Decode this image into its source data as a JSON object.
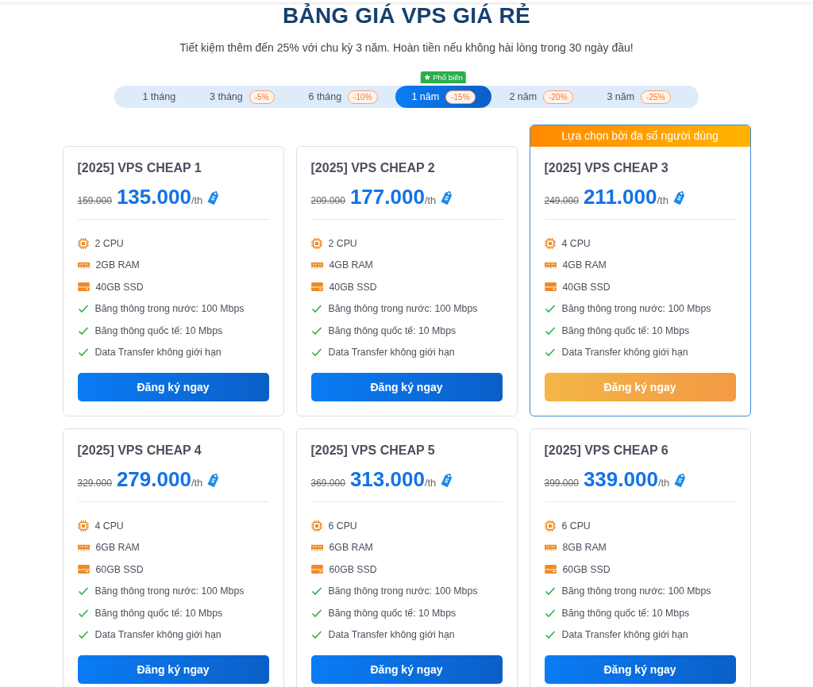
{
  "title": "BẢNG GIÁ VPS GIÁ RẺ",
  "subtitle": "Tiết kiệm thêm đến 25% với chu kỳ 3 năm. Hoàn tiền nếu không hài lòng trong 30 ngày đầu!",
  "tabs": [
    {
      "label": "1 tháng",
      "selected": false
    },
    {
      "label": "3 tháng",
      "discount": "-5%",
      "selected": false
    },
    {
      "label": "6 tháng",
      "discount": "-10%",
      "selected": false
    },
    {
      "label": "1 năm",
      "discount": "-15%",
      "badge": "Phổ biến",
      "selected": true
    },
    {
      "label": "2 năm",
      "discount": "-20%",
      "selected": false
    },
    {
      "label": "3 năm",
      "discount": "-25%",
      "selected": false
    }
  ],
  "plans": [
    {
      "name": "[2025] VPS CHEAP 1",
      "old_price": "159.000",
      "price": "135.000",
      "unit": "/th",
      "featured": false,
      "specs": [
        {
          "kind": "cpu",
          "text": "2 CPU"
        },
        {
          "kind": "ram",
          "text": "2GB RAM"
        },
        {
          "kind": "ssd",
          "text": "40GB SSD"
        },
        {
          "kind": "check",
          "text": "Băng thông trong nước: 100 Mbps"
        },
        {
          "kind": "check",
          "text": "Băng thông quốc tế: 10 Mbps"
        },
        {
          "kind": "check",
          "text": "Data Transfer không giới hạn"
        }
      ],
      "button": "Đăng ký ngay"
    },
    {
      "name": "[2025] VPS CHEAP 2",
      "old_price": "209.000",
      "price": "177.000",
      "unit": "/th",
      "featured": false,
      "specs": [
        {
          "kind": "cpu",
          "text": "2 CPU"
        },
        {
          "kind": "ram",
          "text": "4GB RAM"
        },
        {
          "kind": "ssd",
          "text": "40GB SSD"
        },
        {
          "kind": "check",
          "text": "Băng thông trong nước: 100 Mbps"
        },
        {
          "kind": "check",
          "text": "Băng thông quốc tế: 10 Mbps"
        },
        {
          "kind": "check",
          "text": "Data Transfer không giới hạn"
        }
      ],
      "button": "Đăng ký ngay"
    },
    {
      "name": "[2025] VPS CHEAP 3",
      "old_price": "249.000",
      "price": "211.000",
      "unit": "/th",
      "featured": true,
      "banner": "Lựa chọn bởi đa số người dùng",
      "specs": [
        {
          "kind": "cpu",
          "text": "4 CPU"
        },
        {
          "kind": "ram",
          "text": "4GB RAM"
        },
        {
          "kind": "ssd",
          "text": "40GB SSD"
        },
        {
          "kind": "check",
          "text": "Băng thông trong nước: 100 Mbps"
        },
        {
          "kind": "check",
          "text": "Băng thông quốc tế: 10 Mbps"
        },
        {
          "kind": "check",
          "text": "Data Transfer không giới hạn"
        }
      ],
      "button": "Đăng ký ngay"
    },
    {
      "name": "[2025] VPS CHEAP 4",
      "old_price": "329.000",
      "price": "279.000",
      "unit": "/th",
      "featured": false,
      "specs": [
        {
          "kind": "cpu",
          "text": "4 CPU"
        },
        {
          "kind": "ram",
          "text": "6GB RAM"
        },
        {
          "kind": "ssd",
          "text": "60GB SSD"
        },
        {
          "kind": "check",
          "text": "Băng thông trong nước: 100 Mbps"
        },
        {
          "kind": "check",
          "text": "Băng thông quốc tế: 10 Mbps"
        },
        {
          "kind": "check",
          "text": "Data Transfer không giới hạn"
        }
      ],
      "button": "Đăng ký ngay"
    },
    {
      "name": "[2025] VPS CHEAP 5",
      "old_price": "369.000",
      "price": "313.000",
      "unit": "/th",
      "featured": false,
      "specs": [
        {
          "kind": "cpu",
          "text": "6 CPU"
        },
        {
          "kind": "ram",
          "text": "6GB RAM"
        },
        {
          "kind": "ssd",
          "text": "60GB SSD"
        },
        {
          "kind": "check",
          "text": "Băng thông trong nước: 100 Mbps"
        },
        {
          "kind": "check",
          "text": "Băng thông quốc tế: 10 Mbps"
        },
        {
          "kind": "check",
          "text": "Data Transfer không giới hạn"
        }
      ],
      "button": "Đăng ký ngay"
    },
    {
      "name": "[2025] VPS CHEAP 6",
      "old_price": "399.000",
      "price": "339.000",
      "unit": "/th",
      "featured": false,
      "specs": [
        {
          "kind": "cpu",
          "text": "6 CPU"
        },
        {
          "kind": "ram",
          "text": "8GB RAM"
        },
        {
          "kind": "ssd",
          "text": "60GB SSD"
        },
        {
          "kind": "check",
          "text": "Băng thông trong nước: 100 Mbps"
        },
        {
          "kind": "check",
          "text": "Băng thông quốc tế: 10 Mbps"
        },
        {
          "kind": "check",
          "text": "Data Transfer không giới hạn"
        }
      ],
      "button": "Đăng ký ngay"
    }
  ]
}
